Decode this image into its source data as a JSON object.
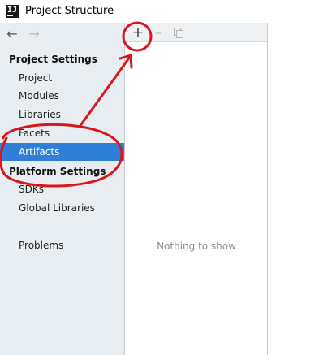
{
  "window": {
    "title": "Project Structure",
    "app_icon_letters": "IJ"
  },
  "navigation": {
    "back_icon": "arrow-left-icon",
    "forward_icon": "arrow-right-icon"
  },
  "sidebar": {
    "project_settings_header": "Project Settings",
    "project_settings_items": [
      {
        "label": "Project"
      },
      {
        "label": "Modules"
      },
      {
        "label": "Libraries"
      },
      {
        "label": "Facets"
      },
      {
        "label": "Artifacts",
        "selected": true
      }
    ],
    "platform_settings_header": "Platform Settings",
    "platform_settings_items": [
      {
        "label": "SDKs"
      },
      {
        "label": "Global Libraries"
      }
    ],
    "other_items": [
      {
        "label": "Problems"
      }
    ]
  },
  "toolbar": {
    "add_icon": "plus-icon",
    "remove_icon": "minus-icon",
    "copy_icon": "copy-icon"
  },
  "content": {
    "empty_message": "Nothing to show"
  },
  "colors": {
    "sidebar_bg": "#e8edf1",
    "selection": "#2f7ed8",
    "annotation": "#d9161c"
  }
}
